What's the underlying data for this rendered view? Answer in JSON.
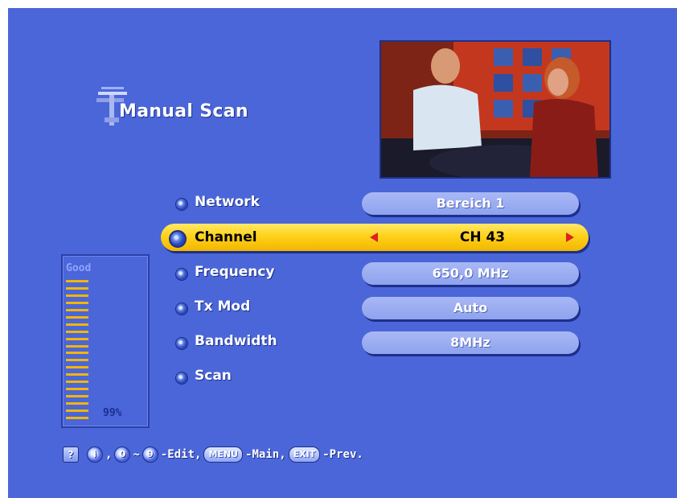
{
  "screen": {
    "title": "Manual Scan",
    "background_color": "#4a66d8",
    "title_icon": "antenna-icon"
  },
  "menu": {
    "network": {
      "label": "Network",
      "value": "Bereich 1"
    },
    "channel": {
      "label": "Channel",
      "value": "CH 43",
      "selected": true
    },
    "frequency": {
      "label": "Frequency",
      "value": "650,0 MHz"
    },
    "tx_mod": {
      "label": "Tx Mod",
      "value": "Auto"
    },
    "bandwidth": {
      "label": "Bandwidth",
      "value": "8MHz"
    },
    "scan": {
      "label": "Scan"
    }
  },
  "signal": {
    "quality_label": "Good",
    "strength_text": "99%",
    "strength": 0.99,
    "bar_color": "#f2b500"
  },
  "help": {
    "key_i": "i",
    "sep_comma": ",",
    "key_0": "0",
    "tilde": "~",
    "key_9": "9",
    "edit": "-Edit,",
    "key_menu": "MENU",
    "main": "-Main,",
    "key_exit": "EXIT",
    "prev": "-Prev."
  },
  "colors": {
    "selection": "#ffd21a",
    "arrow": "#e02020",
    "field": "#9fb0f3"
  }
}
